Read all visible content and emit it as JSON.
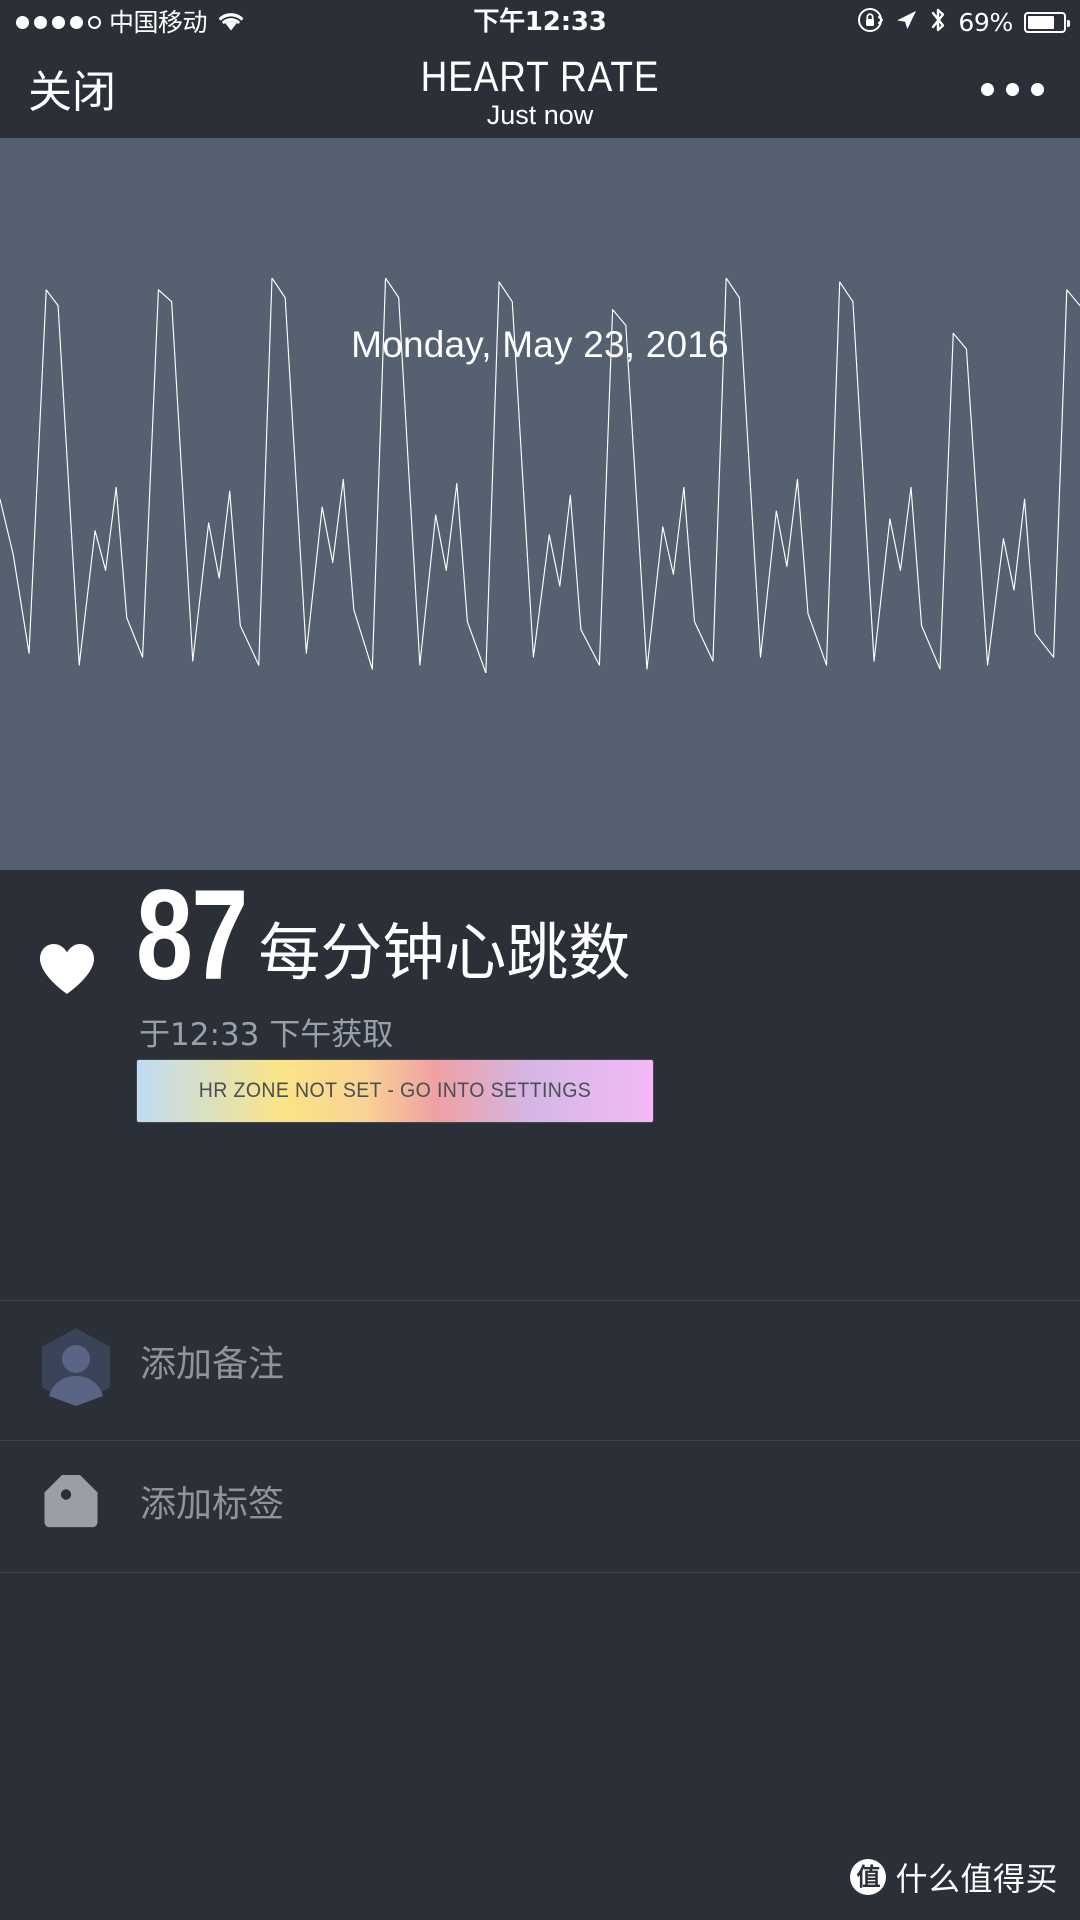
{
  "status_bar": {
    "signal_dots": [
      "filled",
      "filled",
      "filled",
      "filled",
      "hollow"
    ],
    "carrier": "中国移动",
    "wifi_icon": "wifi-icon",
    "time": "下午12:33",
    "rotation_lock_icon": "rotation-lock-icon",
    "location_icon": "location-arrow-icon",
    "bluetooth_icon": "bluetooth-icon",
    "battery_percent": "69%",
    "battery_level": 69
  },
  "nav_bar": {
    "close_label": "关闭",
    "title": "HEART RATE",
    "subtitle": "Just now",
    "more_icon": "more-dots-icon"
  },
  "chart_panel": {
    "date": "Monday, May 23, 2016",
    "background_color": "#556070",
    "line_color": "#ffffff"
  },
  "reading": {
    "heart_icon": "heart-icon",
    "value": "87",
    "unit": "每分钟心跳数",
    "taken_at": "于12:33 下午获取"
  },
  "zone_bar": {
    "text": "HR ZONE NOT SET - GO INTO SETTINGS",
    "gradient_stops": [
      "#bfdcf5",
      "#fbe487",
      "#fad394",
      "#efa0a3",
      "#d4b6e6",
      "#f3b9f5"
    ]
  },
  "rows": [
    {
      "icon": "person-avatar-icon",
      "label": "添加备注"
    },
    {
      "icon": "tag-icon",
      "label": "添加标签"
    }
  ],
  "watermark": {
    "badge": "值",
    "text": "什么值得买"
  },
  "chart_data": {
    "type": "line",
    "title": "Monday, May 23, 2016",
    "xlabel": "",
    "ylabel": "",
    "series": [
      {
        "name": "heart rate waveform",
        "points": [
          [
            0,
            0.44
          ],
          [
            10,
            0.3
          ],
          [
            22,
            0.05
          ],
          [
            35,
            0.97
          ],
          [
            44,
            0.93
          ],
          [
            60,
            0.02
          ],
          [
            72,
            0.36
          ],
          [
            80,
            0.26
          ],
          [
            88,
            0.47
          ],
          [
            96,
            0.14
          ],
          [
            108,
            0.04
          ],
          [
            120,
            0.97
          ],
          [
            130,
            0.94
          ],
          [
            146,
            0.03
          ],
          [
            158,
            0.38
          ],
          [
            166,
            0.24
          ],
          [
            174,
            0.46
          ],
          [
            182,
            0.12
          ],
          [
            196,
            0.02
          ],
          [
            206,
            1.0
          ],
          [
            216,
            0.95
          ],
          [
            232,
            0.05
          ],
          [
            244,
            0.42
          ],
          [
            252,
            0.28
          ],
          [
            260,
            0.49
          ],
          [
            268,
            0.16
          ],
          [
            282,
            0.01
          ],
          [
            292,
            1.0
          ],
          [
            302,
            0.95
          ],
          [
            318,
            0.02
          ],
          [
            330,
            0.4
          ],
          [
            338,
            0.26
          ],
          [
            346,
            0.48
          ],
          [
            354,
            0.13
          ],
          [
            368,
            0.0
          ],
          [
            378,
            0.99
          ],
          [
            388,
            0.94
          ],
          [
            404,
            0.04
          ],
          [
            416,
            0.35
          ],
          [
            424,
            0.22
          ],
          [
            432,
            0.45
          ],
          [
            440,
            0.11
          ],
          [
            454,
            0.02
          ],
          [
            464,
            0.92
          ],
          [
            474,
            0.88
          ],
          [
            490,
            0.01
          ],
          [
            502,
            0.37
          ],
          [
            510,
            0.25
          ],
          [
            518,
            0.47
          ],
          [
            526,
            0.13
          ],
          [
            540,
            0.03
          ],
          [
            550,
            1.0
          ],
          [
            560,
            0.95
          ],
          [
            576,
            0.04
          ],
          [
            588,
            0.41
          ],
          [
            596,
            0.27
          ],
          [
            604,
            0.49
          ],
          [
            612,
            0.15
          ],
          [
            626,
            0.02
          ],
          [
            636,
            0.99
          ],
          [
            646,
            0.94
          ],
          [
            662,
            0.03
          ],
          [
            674,
            0.39
          ],
          [
            682,
            0.26
          ],
          [
            690,
            0.47
          ],
          [
            698,
            0.12
          ],
          [
            712,
            0.01
          ],
          [
            722,
            0.86
          ],
          [
            732,
            0.82
          ],
          [
            748,
            0.02
          ],
          [
            760,
            0.34
          ],
          [
            768,
            0.21
          ],
          [
            776,
            0.44
          ],
          [
            784,
            0.1
          ],
          [
            798,
            0.04
          ],
          [
            808,
            0.97
          ],
          [
            818,
            0.93
          ]
        ],
        "ylim": [
          0,
          1
        ]
      }
    ],
    "grid": false,
    "legend": "none"
  }
}
